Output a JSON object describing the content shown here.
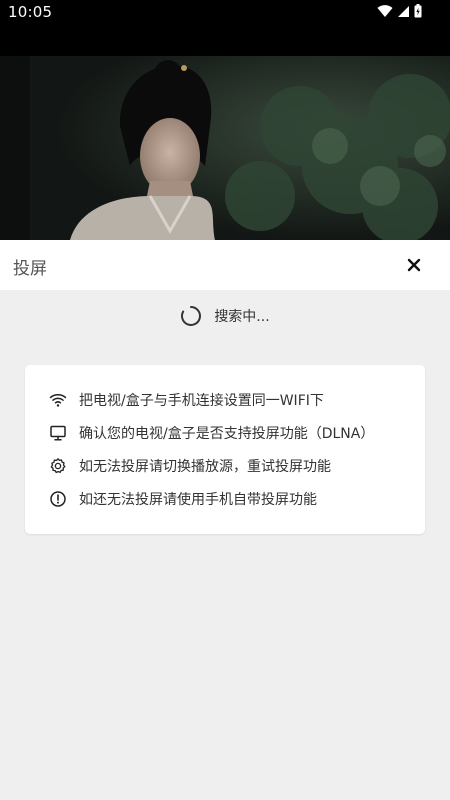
{
  "status_bar": {
    "time": "10:05",
    "icons": [
      "wifi-icon",
      "signal-icon",
      "battery-icon"
    ]
  },
  "video": {
    "description_icon": "video-frame"
  },
  "header": {
    "title": "投屏",
    "close_icon": "close-icon"
  },
  "search": {
    "status_text": "搜索中..."
  },
  "tips": [
    {
      "icon": "wifi-icon",
      "text": "把电视/盒子与手机连接设置同一WIFI下"
    },
    {
      "icon": "monitor-icon",
      "text": "确认您的电视/盒子是否支持投屏功能（DLNA）"
    },
    {
      "icon": "gear-icon",
      "text": "如无法投屏请切换播放源，重试投屏功能"
    },
    {
      "icon": "info-icon",
      "text": "如还无法投屏请使用手机自带投屏功能"
    }
  ],
  "colors": {
    "background": "#efefef",
    "header_bg": "#ffffff",
    "status_bg": "#000000",
    "text": "#333333"
  }
}
